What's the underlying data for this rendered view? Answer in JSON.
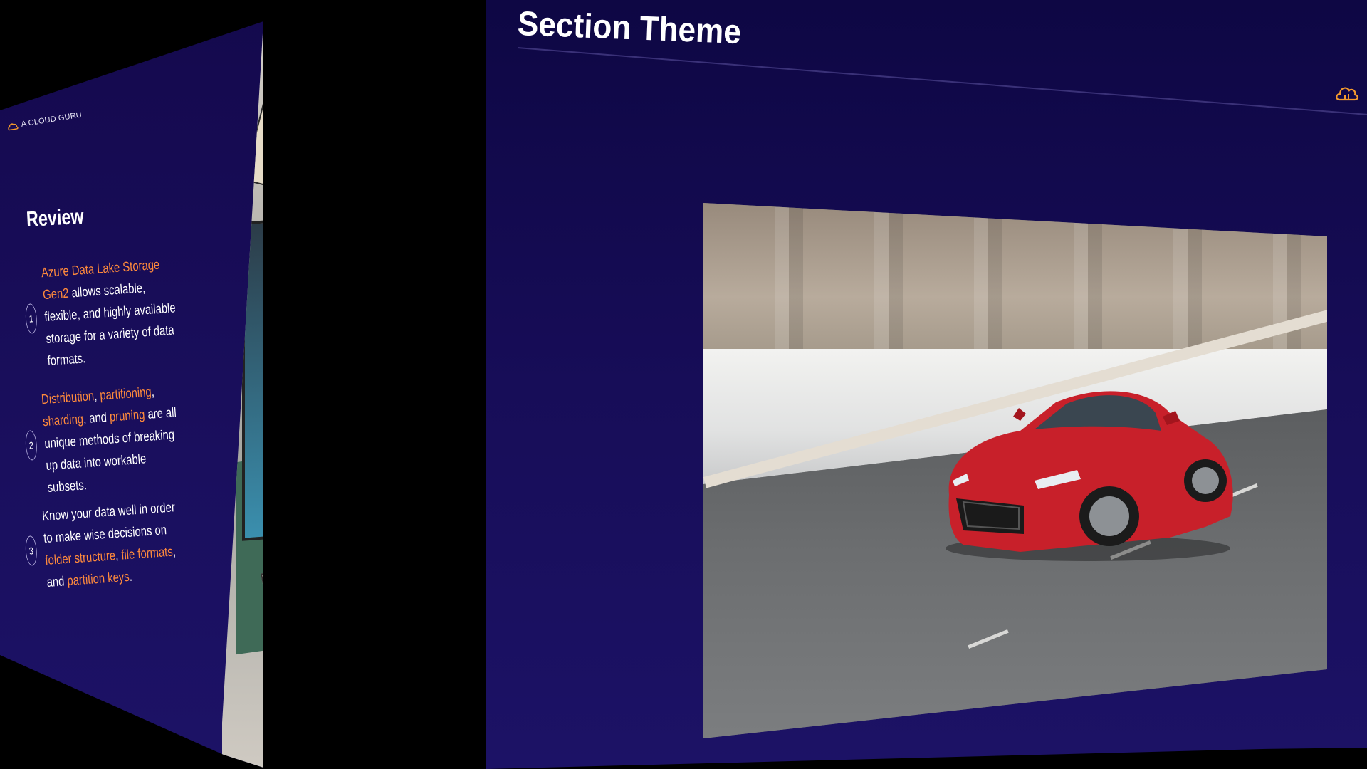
{
  "left_slide": {
    "logo_text": "A CLOUD GURU",
    "review_title": "Review",
    "items": [
      {
        "number": "1",
        "parts": [
          {
            "text": "Azure Data Lake Storage Gen2",
            "highlight": true
          },
          {
            "text": " allows scalable, flexible, and highly available storage for a variety of data formats.",
            "highlight": false
          }
        ]
      },
      {
        "number": "2",
        "parts": [
          {
            "text": "Distribution",
            "highlight": true
          },
          {
            "text": ", ",
            "highlight": false
          },
          {
            "text": "partitioning",
            "highlight": true
          },
          {
            "text": ", ",
            "highlight": false
          },
          {
            "text": "sharding",
            "highlight": true
          },
          {
            "text": ", and ",
            "highlight": false
          },
          {
            "text": "pruning",
            "highlight": true
          },
          {
            "text": " are all unique methods of breaking up data into workable subsets.",
            "highlight": false
          }
        ]
      },
      {
        "number": "3",
        "parts": [
          {
            "text": "Know your data well in order to make wise decisions on ",
            "highlight": false
          },
          {
            "text": "folder structure",
            "highlight": true
          },
          {
            "text": ", ",
            "highlight": false
          },
          {
            "text": "file formats",
            "highlight": true
          },
          {
            "text": ", and ",
            "highlight": false
          },
          {
            "text": "partition keys",
            "highlight": true
          },
          {
            "text": ".",
            "highlight": false
          }
        ]
      }
    ]
  },
  "main_slide": {
    "title": "Section Theme"
  },
  "icons": {
    "logo": "cloud-logo-icon"
  },
  "colors": {
    "background": "#150b52",
    "highlight": "#ff8a3c",
    "text": "#ffffff",
    "logo": "#f39a2e",
    "car": "#c8202a"
  }
}
